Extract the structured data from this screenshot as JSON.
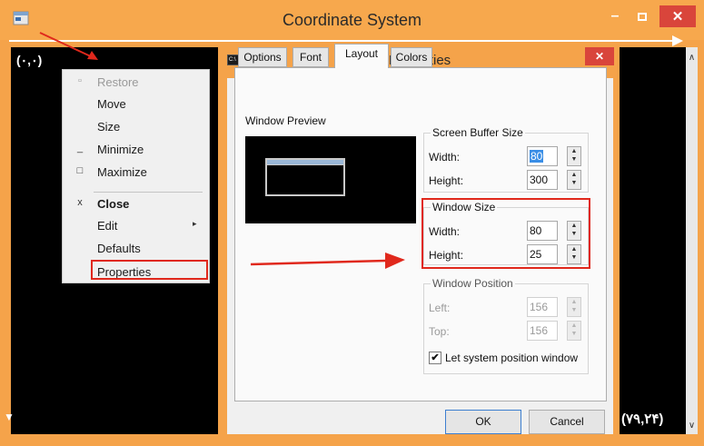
{
  "outer_window": {
    "title": "Coordinate System",
    "minimize_glyph": "–",
    "close_glyph": "✕",
    "coord_start": "(۰,۰)",
    "coord_end": "(۷۹,۲۴)"
  },
  "context_menu": {
    "items": [
      {
        "label": "Restore",
        "glyph": "▫",
        "disabled": true
      },
      {
        "label": "Move",
        "glyph": ""
      },
      {
        "label": "Size",
        "glyph": ""
      },
      {
        "label": "Minimize",
        "glyph": "_"
      },
      {
        "label": "Maximize",
        "glyph": "□"
      },
      {
        "label": "Close",
        "glyph": "x",
        "bold": true
      },
      {
        "label": "Edit",
        "glyph": "",
        "submenu_glyph": "▸"
      },
      {
        "label": "Defaults",
        "glyph": ""
      },
      {
        "label": "Properties",
        "glyph": ""
      }
    ]
  },
  "dialog": {
    "title": "Properties",
    "close_glyph": "✕",
    "title_icon_text": "C:\\",
    "tabs": [
      {
        "label": "Options"
      },
      {
        "label": "Font"
      },
      {
        "label": "Layout",
        "active": true
      },
      {
        "label": "Colors"
      }
    ],
    "window_preview_label": "Window Preview",
    "screen_buffer": {
      "label": "Screen Buffer Size",
      "width_label": "Width:",
      "width_value": "80",
      "height_label": "Height:",
      "height_value": "300"
    },
    "window_size": {
      "label": "Window Size",
      "width_label": "Width:",
      "width_value": "80",
      "height_label": "Height:",
      "height_value": "25"
    },
    "window_position": {
      "label": "Window Position",
      "left_label": "Left:",
      "left_value": "156",
      "top_label": "Top:",
      "top_value": "156"
    },
    "let_system_position": {
      "label": "Let system position window",
      "checked": true,
      "check_glyph": "✔"
    },
    "ok_label": "OK",
    "cancel_label": "Cancel"
  },
  "colors": {
    "title_bar": "#f7a84d",
    "close_button": "#d9453b",
    "highlight_box": "#e0281c",
    "console_bg": "#000000",
    "selection": "#3a8ee6"
  },
  "icons": {
    "spin_up": "▲",
    "spin_down": "▼",
    "scroll_up": "∧",
    "scroll_down": "∨",
    "console_down": "▼"
  }
}
